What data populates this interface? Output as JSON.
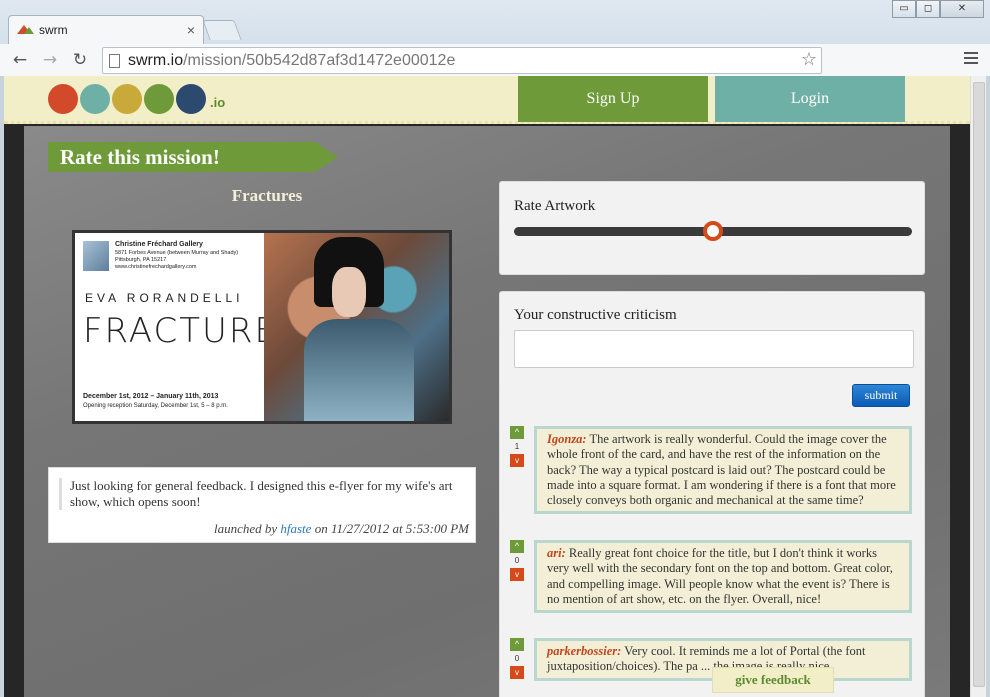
{
  "browser": {
    "tab_title": "swrm",
    "tab_close": "×",
    "url_host": "swrm.io",
    "url_path": "/mission/50b542d87af3d1472e00012e",
    "win_min": "▭",
    "win_max": "◻",
    "win_close": "✕"
  },
  "site": {
    "logo_tld": ".io",
    "signup_label": "Sign Up",
    "login_label": "Login",
    "logo_colors": [
      "#d34a2a",
      "#6fb0a6",
      "#c9a93a",
      "#6e9a3a",
      "#2c4a6e"
    ]
  },
  "mission": {
    "ribbon": "Rate this mission!",
    "title": "Fractures",
    "description": "Just looking for general feedback. I designed this e-flyer for my wife's art show, which opens soon!",
    "launched_prefix": "launched by",
    "launched_user": "hfaste",
    "launched_suffix": "on 11/27/2012 at 5:53:00 PM"
  },
  "flyer": {
    "gallery_name": "Christine Fréchard Gallery",
    "address_1": "5871 Forbes Avenue (between Murray and Shady)",
    "address_2": "Pittsburgh, PA 15217",
    "website": "www.christinefrechardgallery.com",
    "artist": "EVA RORANDELLI",
    "show_title": "FRACTURES",
    "dates": "December 1st, 2012 – January 11th, 2013",
    "reception": "Opening reception Saturday, December 1st, 5 – 8 p.m."
  },
  "rating": {
    "label": "Rate Artwork",
    "value_fraction": 0.5
  },
  "criticism": {
    "label": "Your constructive criticism",
    "input_value": "",
    "submit_label": "submit"
  },
  "comments": [
    {
      "up": "^",
      "score": "1",
      "down": "v",
      "author": "Igonza:",
      "text": "The artwork is really wonderful. Could the image cover the whole front of the card, and have the rest of the information on the back? The way a typical postcard is laid out? The postcard could be made into a square format. I am wondering if there is a font that more closely conveys both organic and mechanical at the same time?"
    },
    {
      "up": "^",
      "score": "0",
      "down": "v",
      "author": "ari:",
      "text": "Really great font choice for the title, but I don't think it works very well with the secondary font on the top and bottom. Great color, and compelling image. Will people know what the event is? There is no mention of art show, etc. on the flyer. Overall, nice!"
    },
    {
      "up": "^",
      "score": "0",
      "down": "v",
      "author": "parkerbossier:",
      "text": "Very cool. It reminds me a lot of Portal (the font juxtaposition/choices). The pa ... the image is really nice."
    }
  ],
  "feedback_label": "give feedback"
}
